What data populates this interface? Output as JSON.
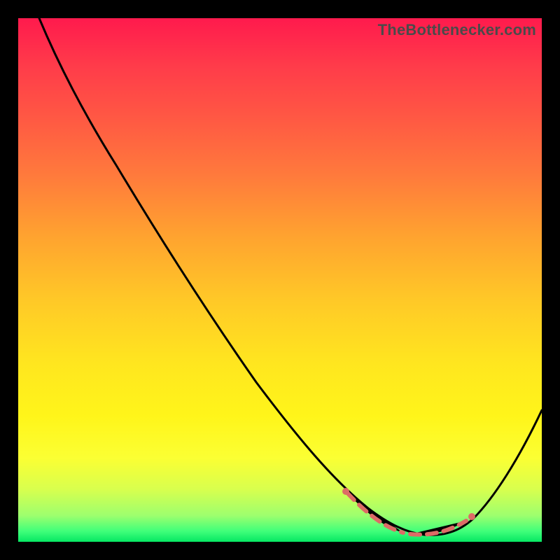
{
  "branding": {
    "text": "TheBottlenecker.com"
  },
  "chart_data": {
    "type": "line",
    "title": "",
    "xlabel": "",
    "ylabel": "",
    "xlim": [
      0,
      100
    ],
    "ylim": [
      0,
      100
    ],
    "grid": false,
    "legend": false,
    "series": [
      {
        "name": "bottleneck-curve",
        "color": "#000000",
        "x": [
          4,
          8,
          12,
          16,
          20,
          24,
          28,
          32,
          36,
          40,
          44,
          48,
          52,
          56,
          60,
          63,
          66,
          69,
          72,
          75,
          78,
          81,
          84,
          87,
          90,
          93,
          96,
          100
        ],
        "values": [
          100,
          94,
          88,
          82,
          76,
          70,
          64,
          58,
          52,
          46,
          40,
          34,
          28,
          23,
          18,
          14,
          10,
          7,
          4,
          2,
          1,
          1,
          2,
          5,
          10,
          16,
          23,
          33
        ]
      },
      {
        "name": "sweet-spot-markers",
        "color": "#dd6b66",
        "style": "dashed",
        "x": [
          63,
          66,
          69,
          72,
          75,
          78,
          81,
          84
        ],
        "values": [
          14,
          10,
          7,
          4,
          2,
          1,
          1,
          2
        ]
      }
    ],
    "background_gradient": {
      "top": "#ff1a4d",
      "bottom": "#06e763"
    }
  }
}
